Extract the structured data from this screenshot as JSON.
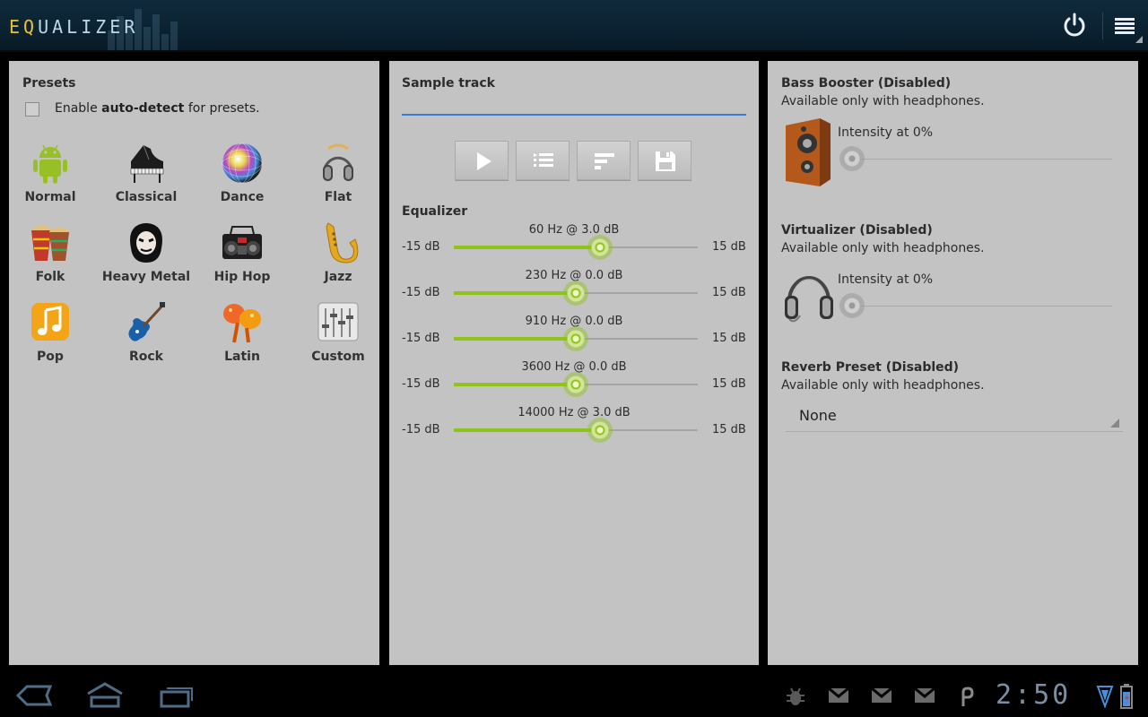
{
  "app": {
    "title_accent": "EQ",
    "title_rest": "UALIZER",
    "power_icon": "power-icon",
    "menu_icon": "overflow-menu-icon"
  },
  "presets": {
    "title": "Presets",
    "autodetect": {
      "checked": false,
      "prefix": "Enable ",
      "bold": "auto-detect",
      "suffix": " for presets."
    },
    "items": [
      {
        "label": "Normal",
        "icon": "android-icon"
      },
      {
        "label": "Classical",
        "icon": "piano-icon"
      },
      {
        "label": "Dance",
        "icon": "disco-ball-icon"
      },
      {
        "label": "Flat",
        "icon": "headphones-icon"
      },
      {
        "label": "Folk",
        "icon": "drums-icon"
      },
      {
        "label": "Heavy Metal",
        "icon": "metal-face-icon"
      },
      {
        "label": "Hip Hop",
        "icon": "boombox-icon"
      },
      {
        "label": "Jazz",
        "icon": "saxophone-icon"
      },
      {
        "label": "Pop",
        "icon": "music-note-icon"
      },
      {
        "label": "Rock",
        "icon": "electric-guitar-icon"
      },
      {
        "label": "Latin",
        "icon": "maracas-icon"
      },
      {
        "label": "Custom",
        "icon": "mixer-sliders-icon"
      }
    ]
  },
  "sample_track": {
    "title": "Sample track",
    "value": "",
    "buttons": [
      {
        "name": "play-button",
        "icon": "play-icon"
      },
      {
        "name": "playlist-button",
        "icon": "list-icon"
      },
      {
        "name": "sort-button",
        "icon": "sort-bars-icon"
      },
      {
        "name": "save-button",
        "icon": "floppy-disk-icon"
      }
    ]
  },
  "equalizer": {
    "title": "Equalizer",
    "min_db": -15,
    "max_db": 15,
    "min_label": "-15 dB",
    "max_label": "15 dB",
    "bands": [
      {
        "label": "60 Hz @ 3.0 dB",
        "gain": 3.0
      },
      {
        "label": "230 Hz @ 0.0 dB",
        "gain": 0.0
      },
      {
        "label": "910 Hz @ 0.0 dB",
        "gain": 0.0
      },
      {
        "label": "3600 Hz @ 0.0 dB",
        "gain": 0.0
      },
      {
        "label": "14000 Hz @ 3.0 dB",
        "gain": 3.0
      }
    ]
  },
  "effects": {
    "bass": {
      "title": "Bass Booster (Disabled)",
      "note": "Available only with headphones.",
      "intensity_label": "Intensity at 0%",
      "intensity": 0,
      "icon": "speaker-icon"
    },
    "virtualizer": {
      "title": "Virtualizer (Disabled)",
      "note": "Available only with headphones.",
      "intensity_label": "Intensity at 0%",
      "intensity": 0,
      "icon": "headphones-icon"
    },
    "reverb": {
      "title": "Reverb Preset (Disabled)",
      "note": "Available only with headphones.",
      "selected": "None"
    }
  },
  "system": {
    "clock": "2:50",
    "nav": [
      "back-icon",
      "home-icon",
      "recent-apps-icon"
    ],
    "notifications": [
      "android-debug-icon",
      "gmail-icon",
      "gmail-icon",
      "gmail-icon",
      "p-icon"
    ],
    "status": [
      "wifi-icon",
      "battery-icon"
    ]
  },
  "colors": {
    "accent_green": "#8ec318",
    "panel_bg": "#c3c3c3",
    "actionbar_bg": "#0b2231",
    "track_blue": "#3a7bd5",
    "logo_yellow": "#e6c23a"
  }
}
